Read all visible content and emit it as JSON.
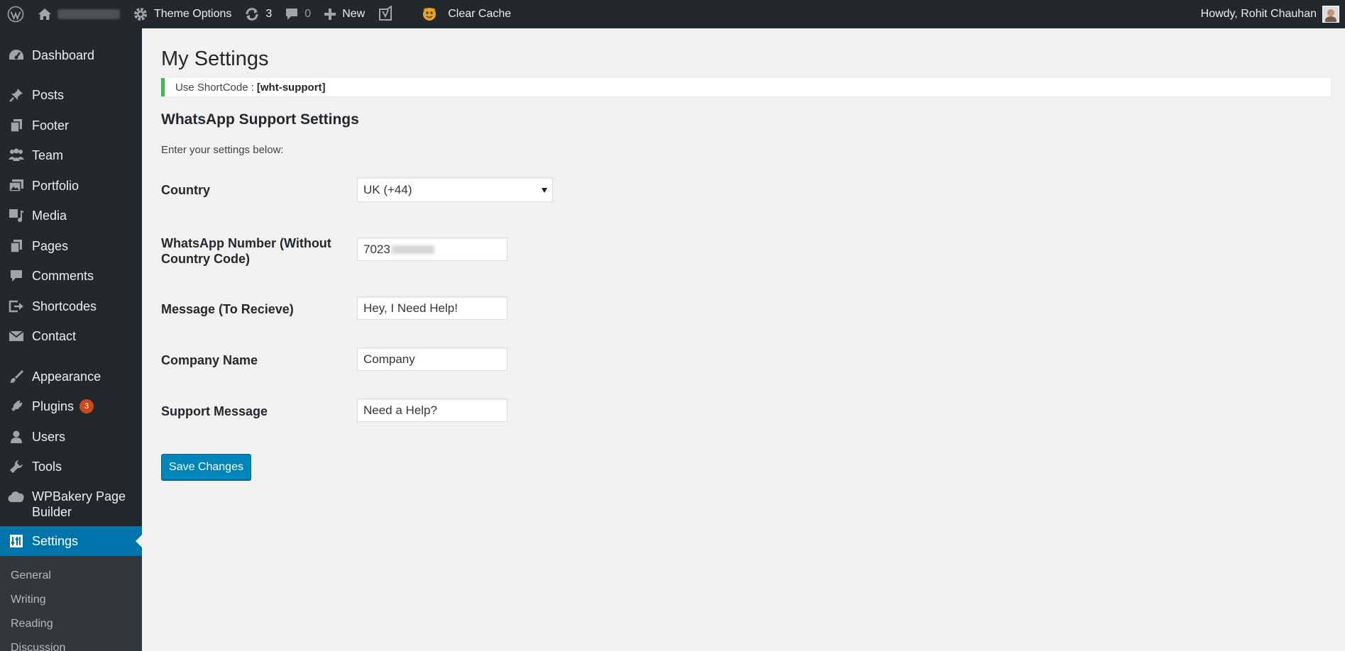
{
  "admin_bar": {
    "theme_options": "Theme Options",
    "updates_count": "3",
    "comments_count": "0",
    "new_label": "New",
    "clear_cache": "Clear Cache",
    "howdy": "Howdy, Rohit Chauhan"
  },
  "sidebar": {
    "items": [
      {
        "label": "Dashboard"
      },
      {
        "label": "Posts"
      },
      {
        "label": "Footer"
      },
      {
        "label": "Team"
      },
      {
        "label": "Portfolio"
      },
      {
        "label": "Media"
      },
      {
        "label": "Pages"
      },
      {
        "label": "Comments"
      },
      {
        "label": "Shortcodes"
      },
      {
        "label": "Contact"
      },
      {
        "label": "Appearance"
      },
      {
        "label": "Plugins",
        "badge": "3"
      },
      {
        "label": "Users"
      },
      {
        "label": "Tools"
      },
      {
        "label": "WPBakery Page Builder"
      },
      {
        "label": "Settings"
      }
    ],
    "submenu": [
      "General",
      "Writing",
      "Reading",
      "Discussion"
    ],
    "current": "Settings"
  },
  "page": {
    "title": "My Settings",
    "notice_prefix": "Use ShortCode :",
    "notice_code": "[wht-support]",
    "section_title": "WhatsApp Support Settings",
    "section_desc": "Enter your settings below:",
    "fields": {
      "country": {
        "label": "Country",
        "value": "UK (+44)"
      },
      "number": {
        "label": "WhatsApp Number (Without Country Code)",
        "value": "7023"
      },
      "message": {
        "label": "Message (To Recieve)",
        "value": "Hey, I Need Help!"
      },
      "company": {
        "label": "Company Name",
        "value": "Company"
      },
      "support": {
        "label": "Support Message",
        "value": "Need a Help?"
      }
    },
    "save_label": "Save Changes"
  },
  "colors": {
    "admin_bar_bg": "#23282d",
    "menu_current": "#0073aa",
    "notice_border": "#46b450",
    "button_primary": "#0085ba",
    "badge": "#ca4a1f"
  }
}
